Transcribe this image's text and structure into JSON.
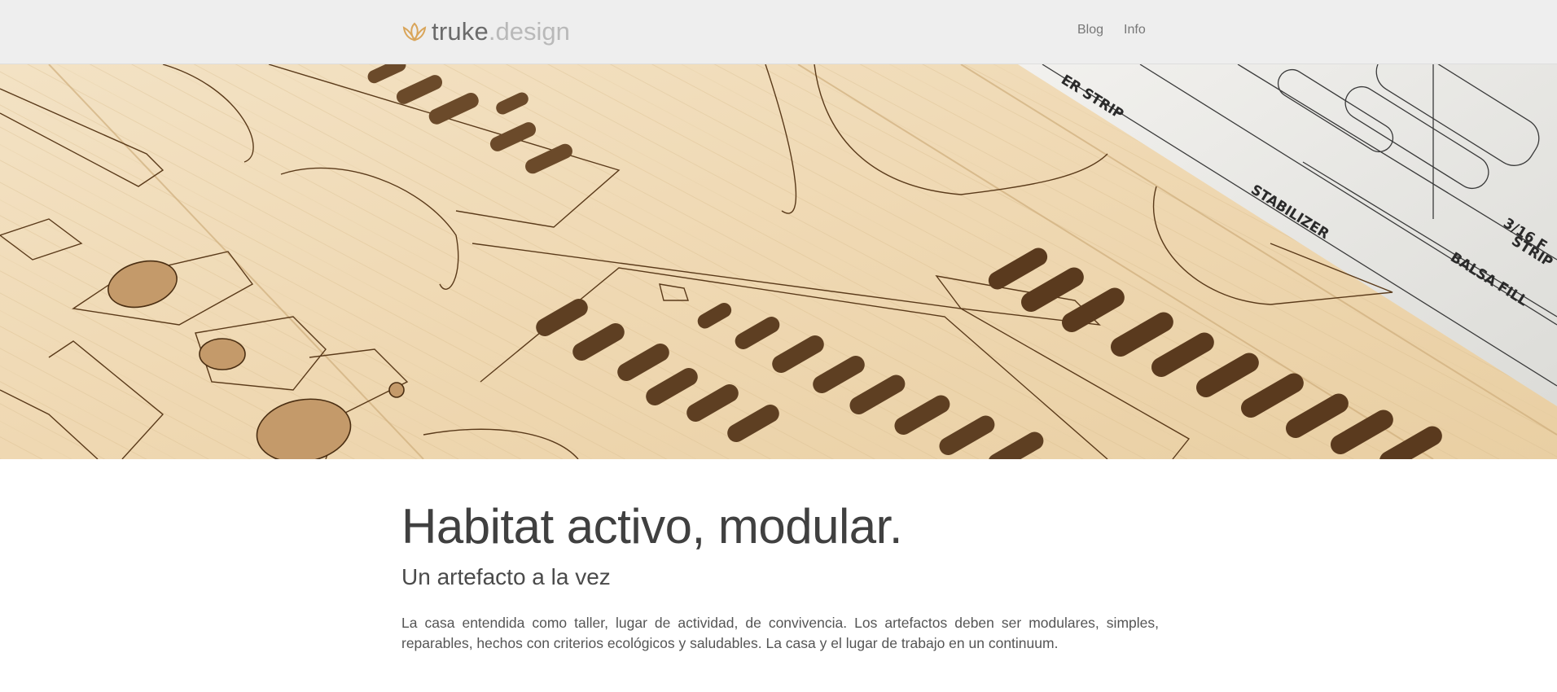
{
  "brand": {
    "name": "truke",
    "dot": ".",
    "tld": "design",
    "icon": "lotus-icon",
    "accent_color": "#d9a55a"
  },
  "nav": {
    "items": [
      {
        "label": "Blog"
      },
      {
        "label": "Info"
      }
    ]
  },
  "hero": {
    "image": "laser-cut-balsa-wood-sheets-over-blueprint",
    "blueprint_labels": [
      "ER STRIP",
      "STABILIZER",
      "3/16 F",
      "STRIP",
      "BALSA FILL"
    ]
  },
  "main": {
    "headline": "Habitat activo, modular.",
    "subheadline": "Un artefacto a la vez",
    "intro": "La casa entendida como taller, lugar de actividad, de convivencia. Los artefactos deben ser modulares, simples, reparables, hechos con criterios ecológicos y saludables. La casa y el lugar de trabajo en un continuum."
  },
  "colors": {
    "navbar_bg": "#eeeeee",
    "text": "#404040",
    "wood": "#ecd5b0"
  }
}
